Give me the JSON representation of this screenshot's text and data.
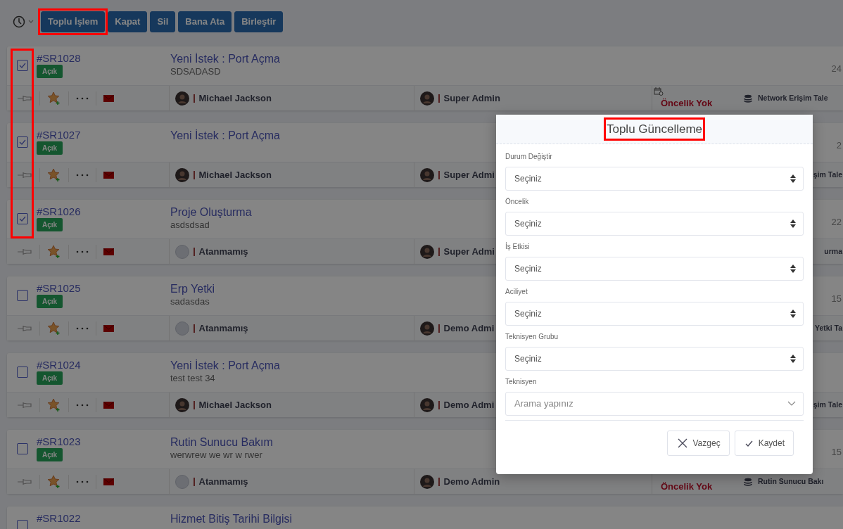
{
  "toolbar": {
    "buttons": [
      {
        "label": "Toplu İşlem",
        "highlighted": true
      },
      {
        "label": "Kapat",
        "highlighted": false
      },
      {
        "label": "Sil",
        "highlighted": false
      },
      {
        "label": "Bana Ata",
        "highlighted": false
      },
      {
        "label": "Birleştir",
        "highlighted": false
      }
    ]
  },
  "rows": [
    {
      "id": "#SR1028",
      "status": "Açık",
      "title": "Yeni İstek : Port Açma",
      "description": "SDSADASD",
      "checked": true,
      "highlighted": true,
      "assignee": "Michael Jackson",
      "assignee_avatar": true,
      "technician": "Super Admin",
      "priority": "Öncelik Yok",
      "category": "Network Erişim Tale",
      "date": "24"
    },
    {
      "id": "#SR1027",
      "status": "Açık",
      "title": "Yeni İstek : Port Açma",
      "checked": true,
      "highlighted": true,
      "assignee": "Michael Jackson",
      "assignee_avatar": true,
      "technician": "Super Admi",
      "category": "şim Tale",
      "date": "2"
    },
    {
      "id": "#SR1026",
      "status": "Açık",
      "title": "Proje Oluşturma",
      "description": "asdsdsad",
      "checked": true,
      "highlighted": true,
      "assignee": "Atanmamış",
      "assignee_avatar": false,
      "technician": "Super Admi",
      "category": "urma",
      "date": "22"
    },
    {
      "id": "#SR1025",
      "status": "Açık",
      "title": "Erp Yetki",
      "description": "sadasdas",
      "checked": false,
      "highlighted": false,
      "assignee": "Atanmamış",
      "assignee_avatar": false,
      "technician": "Demo Admi",
      "category": "Yetki Ta",
      "date": "15"
    },
    {
      "id": "#SR1024",
      "status": "Açık",
      "title": "Yeni İstek : Port Açma",
      "description": "test test 34",
      "checked": false,
      "highlighted": false,
      "assignee": "Michael Jackson",
      "assignee_avatar": true,
      "technician": "Demo Admi",
      "category": "şim Tale"
    },
    {
      "id": "#SR1023",
      "status": "Açık",
      "title": "Rutin Sunucu Bakım",
      "description": "werwrew we wr w rwer",
      "checked": false,
      "highlighted": false,
      "assignee": "Atanmamış",
      "assignee_avatar": false,
      "technician": "Demo Admin",
      "priority": "Öncelik Yok",
      "category": "Rutin Sunucu Bakı",
      "date": "15"
    },
    {
      "id": "#SR1022",
      "title": "Hizmet Bitiş Tarihi Bilgisi",
      "checked": false,
      "highlighted": false
    }
  ],
  "modal": {
    "title": "Toplu Güncelleme",
    "title_highlighted": true,
    "fields": [
      {
        "label": "Durum Değiştir",
        "kind": "select",
        "value": "Seçiniz"
      },
      {
        "label": "Öncelik",
        "kind": "select",
        "value": "Seçiniz"
      },
      {
        "label": "İş Etkisi",
        "kind": "select",
        "value": "Seçiniz"
      },
      {
        "label": "Aciliyet",
        "kind": "select",
        "value": "Seçiniz"
      },
      {
        "label": "Teknisyen Grubu",
        "kind": "select",
        "value": "Seçiniz"
      },
      {
        "label": "Teknisyen",
        "kind": "search",
        "placeholder": "Arama yapınız"
      }
    ],
    "buttons": [
      {
        "label": "Vazgeç",
        "kind": "cancel"
      },
      {
        "label": "Kaydet",
        "kind": "save"
      }
    ]
  }
}
